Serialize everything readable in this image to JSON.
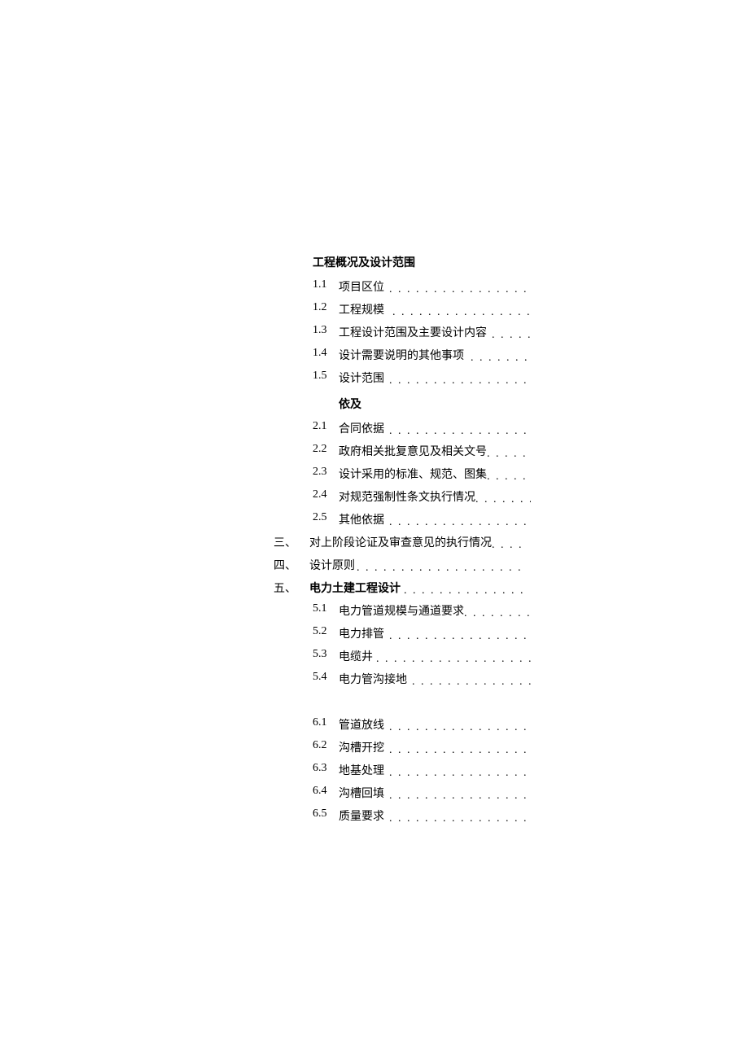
{
  "toc": {
    "sections": [
      {
        "prefix": "",
        "heading": "工程概况及设计范围",
        "subs": [
          {
            "num": "1.1",
            "title": "项目区位",
            "dots": ". . . . . . . . . . . . . . . . . . . . . . . . ."
          },
          {
            "num": "1.2",
            "title": "工程规模",
            "dots": ". . . . . . . . . . . . . . . . . . . . . . . ."
          },
          {
            "num": "1.3",
            "title": "工程设计范围及主要设计内容",
            "dots": ". . . . . . ."
          },
          {
            "num": "1.4",
            "title": "设计需要说明的其他事项",
            "dots": ". . . . . . . . . . ."
          },
          {
            "num": "1.5",
            "title": "设计范围",
            "dots": ". . . . . . . . . . . . . . . . . . . . . . . . ."
          }
        ]
      },
      {
        "prefix": "",
        "heading": "依及",
        "subs": [
          {
            "num": "2.1",
            "title": "合同依据",
            "dots": ". . . . . . . . . . . . . . . . . . . . . . . . ."
          },
          {
            "num": "2.2",
            "title": "政府相关批复意见及相关文号",
            "dots": ". . . . . . . ."
          },
          {
            "num": "2.3",
            "title": "设计采用的标准、规范、图集",
            "dots": ". . . . . . . ."
          },
          {
            "num": "2.4",
            "title": "对规范强制性条文执行情况",
            "dots": ". . . . . . . . . ."
          },
          {
            "num": "2.5",
            "title": "其他依据",
            "dots": ". . . . . . . . . . . . . . . . . . . . . . . . ."
          }
        ]
      },
      {
        "prefix": "三、",
        "title": "对上阶段论证及审查意见的执行情况",
        "dots": ". . . . . . . ."
      },
      {
        "prefix": "四、",
        "title": "设计原则",
        "dots": ". . . . . . . . . . . . . . . . . . . . . . . . . . . . . ."
      },
      {
        "prefix": "五、",
        "title": "电力土建工程设计",
        "dots": ". . . . . . . . . . . . . . . . . . . . .",
        "subs": [
          {
            "num": "5.1",
            "title": "电力管道规模与通道要求",
            "dots": ". . . . . . . . . . . ."
          },
          {
            "num": "5.2",
            "title": "电力排管",
            "dots": ". . . . . . . . . . . . . . . . . . . . . . . . ."
          },
          {
            "num": "5.3",
            "title": "电缆井",
            "dots": ". . . . . . . . . . . . . . . . . . . . . . . . . . ."
          },
          {
            "num": "5.4",
            "title": "电力管沟接地",
            "dots": ". . . . . . . . . . . . . . . . . . . . ."
          }
        ]
      },
      {
        "prefix": "",
        "title": "",
        "subs": [
          {
            "num": "6.1",
            "title": "管道放线",
            "dots": ". . . . . . . . . . . . . . . . . . . . . . . . ."
          },
          {
            "num": "6.2",
            "title": "沟槽开挖",
            "dots": ". . . . . . . . . . . . . . . . . . . . . . . . ."
          },
          {
            "num": "6.3",
            "title": "地基处理",
            "dots": ". . . . . . . . . . . . . . . . . . . . . . . . ."
          },
          {
            "num": "6.4",
            "title": "沟槽回填",
            "dots": ". . . . . . . . . . . . . . . . . . . . . . . . ."
          },
          {
            "num": "6.5",
            "title": "质量要求",
            "dots": ". . . . . . . . . . . . . . . . . . . . . . . . ."
          }
        ]
      }
    ]
  }
}
